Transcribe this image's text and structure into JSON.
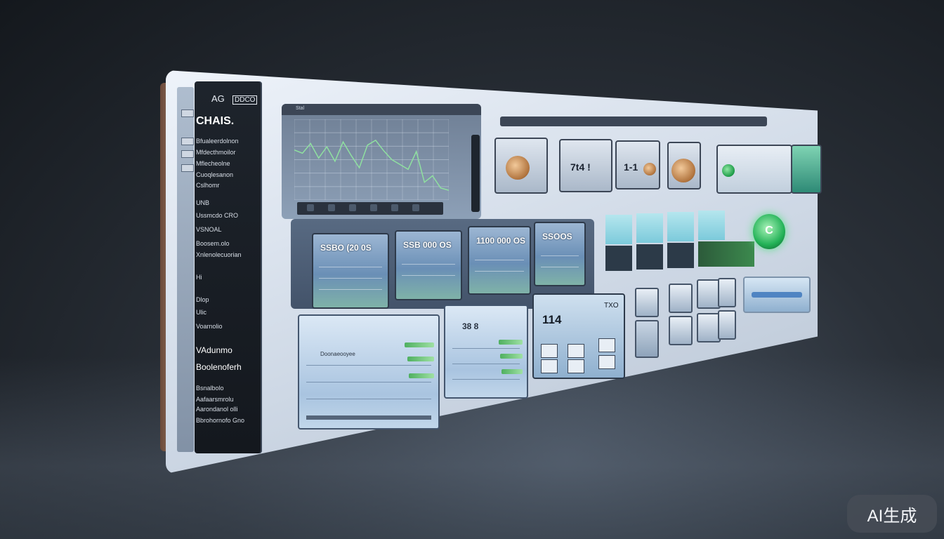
{
  "sidebar": {
    "brand": "AG",
    "badge": "DDCO",
    "title": "CHAIS.",
    "items": [
      {
        "label": "Bfualeerdolnon"
      },
      {
        "label": "Mfdecthmoilor"
      },
      {
        "label": "Mflecheolne"
      },
      {
        "label": "Cuoqlesanon"
      },
      {
        "label": "Cslhomr"
      },
      {
        "label": "UNB"
      },
      {
        "label": "Ussmcdo CRO"
      },
      {
        "label": "VSNOAL"
      },
      {
        "label": "Boosem.olo"
      },
      {
        "label": "Xnlenolecuorian"
      },
      {
        "label": "Hi"
      },
      {
        "label": "Dlop"
      },
      {
        "label": "Ulic"
      },
      {
        "label": "Voarnolio"
      },
      {
        "label": "VAdunmo",
        "big": true
      },
      {
        "label": "Boolenoferh",
        "big": true
      },
      {
        "label": "Bsnalbolo"
      },
      {
        "label": "Aafaarsmrolu"
      },
      {
        "label": "Aarondanol olli"
      },
      {
        "label": "Bbrohornofo Gno"
      }
    ]
  },
  "chart": {
    "header": "Stal",
    "values": [
      62,
      58,
      70,
      52,
      66,
      48,
      72,
      55,
      40,
      68,
      74,
      61,
      50,
      44,
      38,
      60,
      22,
      30,
      15,
      12
    ]
  },
  "tiles": [
    {
      "value": ""
    },
    {
      "value": "7t4 !"
    },
    {
      "value": "1-1 "
    },
    {
      "value": ""
    }
  ],
  "metrics": [
    {
      "value": "SSBO (20 0S"
    },
    {
      "value": "SSB 000 OS"
    },
    {
      "value": "1100 000 OS"
    },
    {
      "value": "SSOOS"
    }
  ],
  "big_button": {
    "label": "C"
  },
  "tables": {
    "left": {
      "header": "Doonaeooyee"
    },
    "right": {
      "header": "38 8"
    }
  },
  "calc": {
    "display": "114",
    "label": "TXO"
  },
  "watermark": "AI生成",
  "colors": {
    "accent": "#23b257",
    "panel": "#3c4656",
    "tile": "#9cb6d3"
  }
}
